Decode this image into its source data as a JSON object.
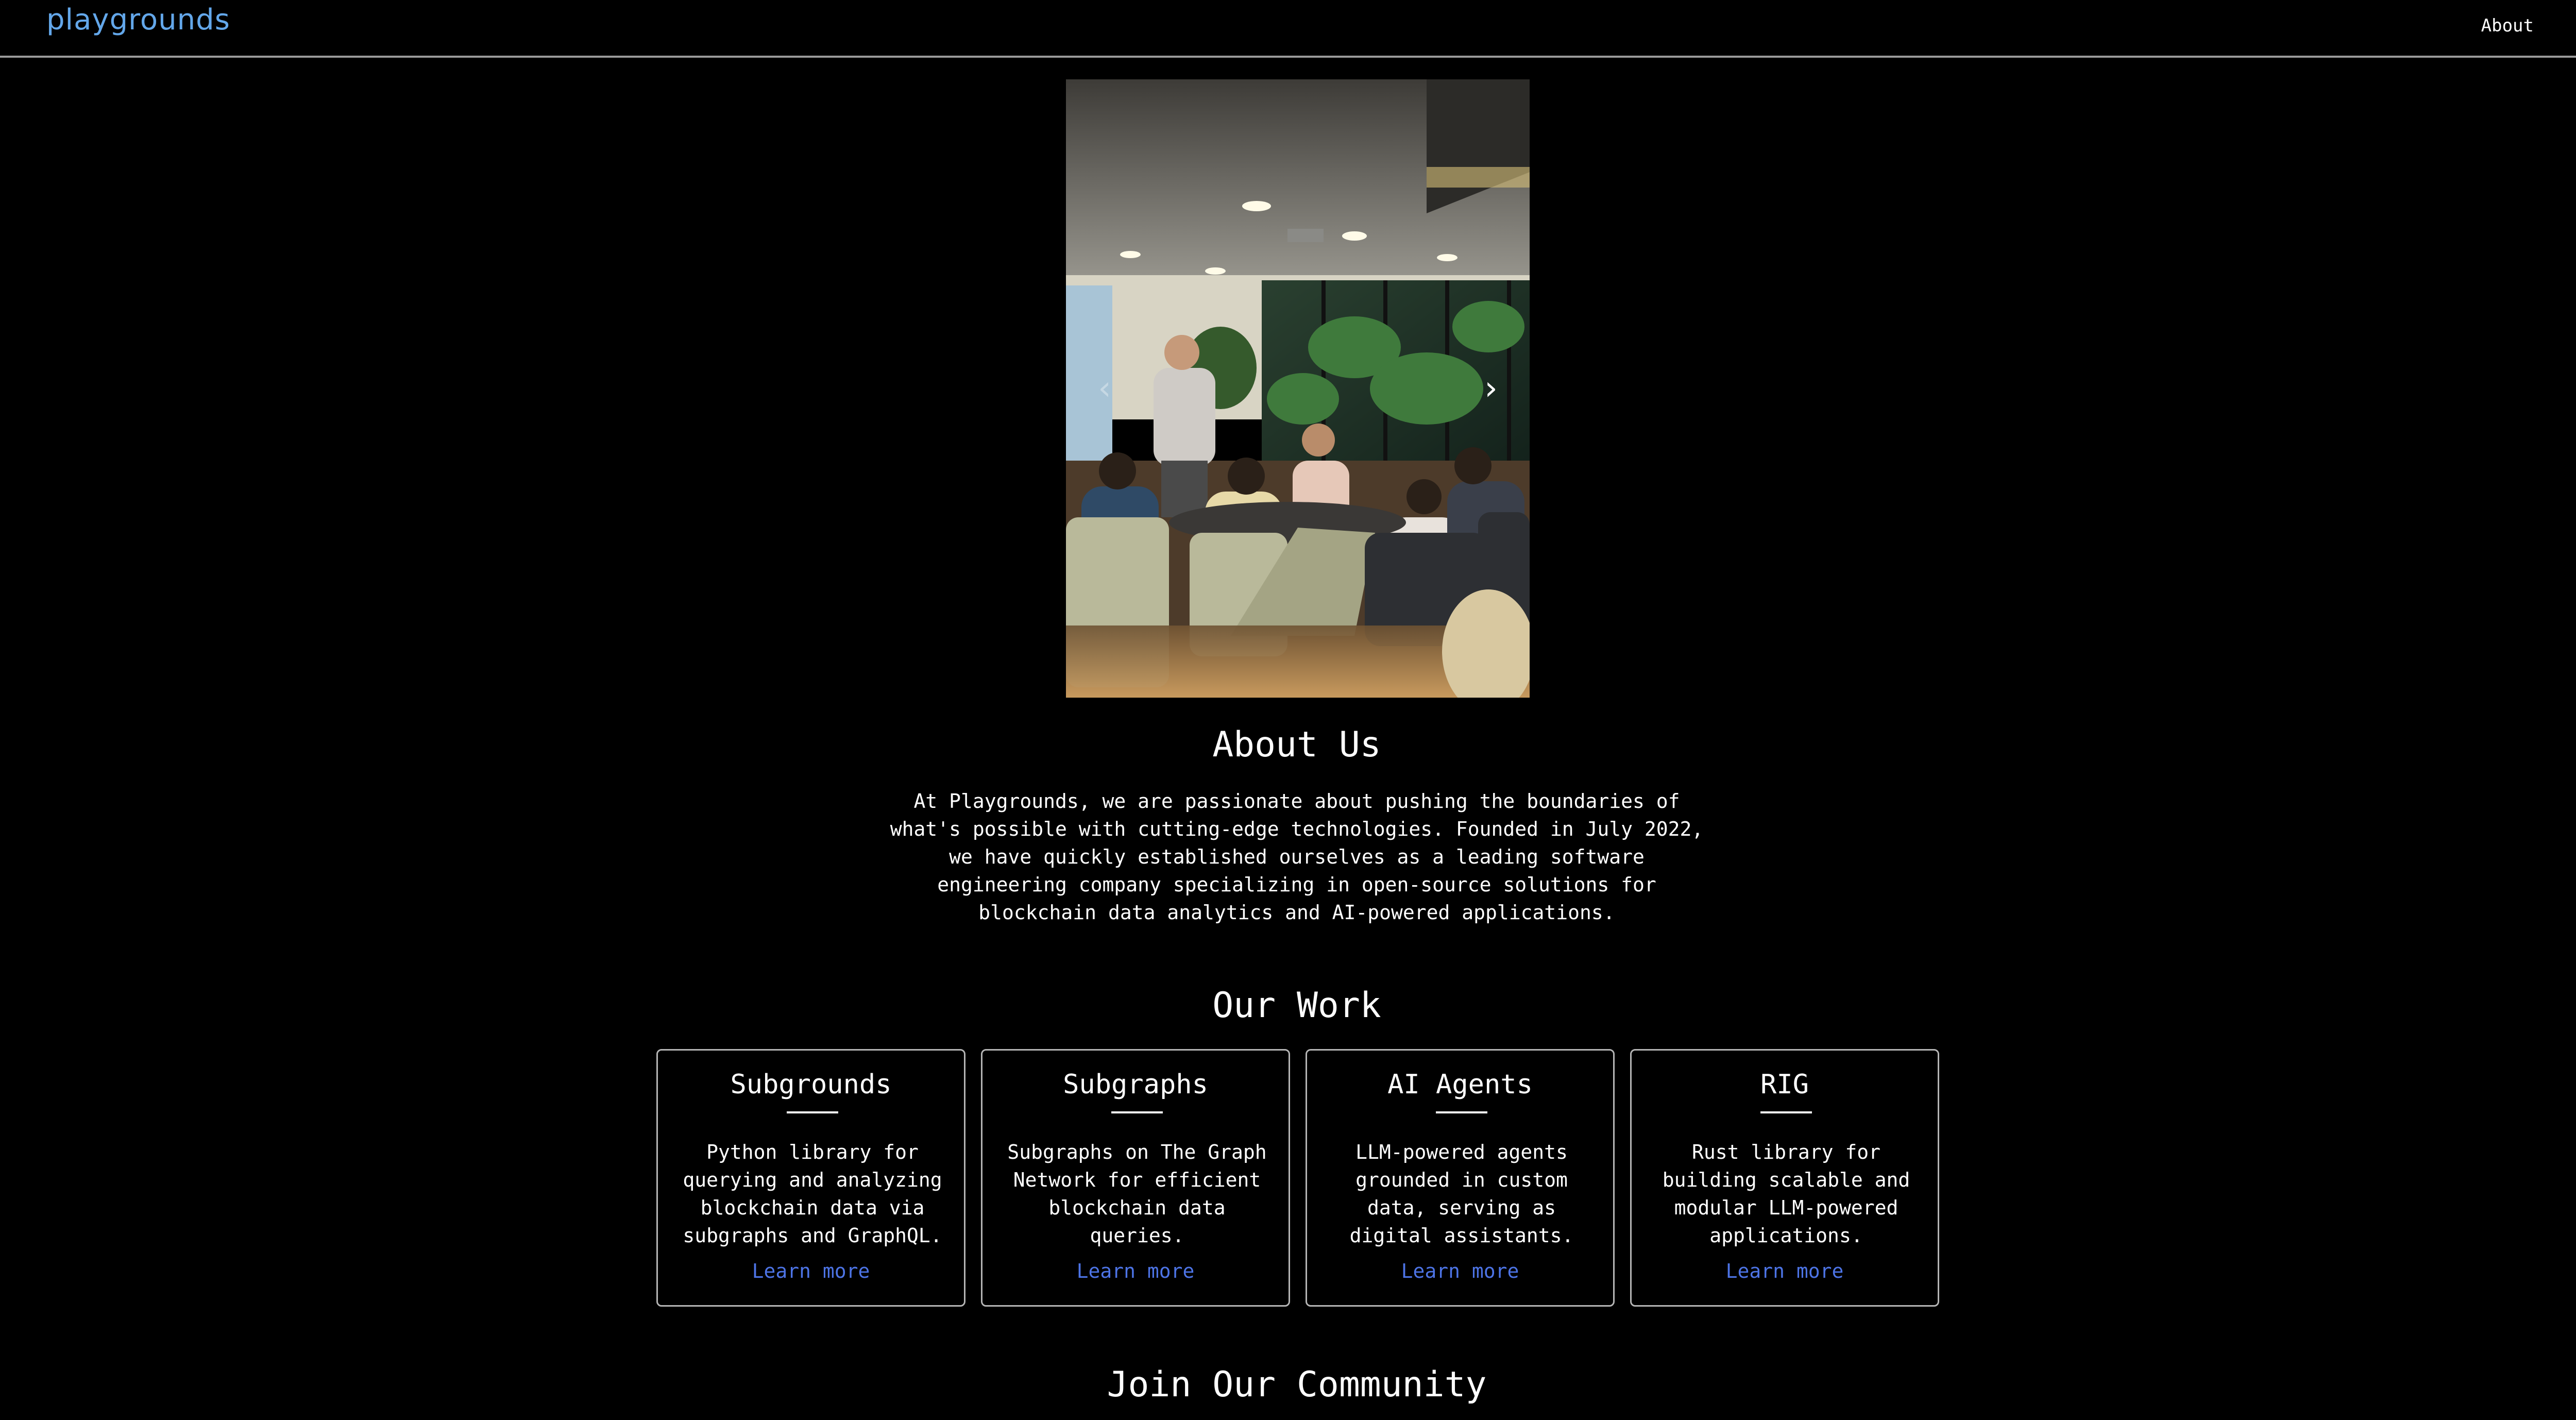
{
  "nav": {
    "logo": "playgrounds",
    "about_link": "About"
  },
  "carousel": {
    "prev_icon": "chevron-left-icon",
    "next_icon": "chevron-right-icon",
    "prev_glyph": "‹",
    "next_glyph": "›"
  },
  "about": {
    "title": "About Us",
    "text": "At Playgrounds, we are passionate about pushing the boundaries of what's possible with cutting-edge technologies. Founded in July 2022, we have quickly established ourselves as a leading software engineering company specializing in open-source solutions for blockchain data analytics and AI-powered applications."
  },
  "work": {
    "title": "Our Work",
    "cards": [
      {
        "title": "Subgrounds",
        "description": "Python library for querying and analyzing blockchain data via subgraphs and GraphQL.",
        "link": "Learn more"
      },
      {
        "title": "Subgraphs",
        "description": "Subgraphs on The Graph Network for efficient blockchain data queries.",
        "link": "Learn more"
      },
      {
        "title": "AI Agents",
        "description": "LLM-powered agents grounded in custom data, serving as digital assistants.",
        "link": "Learn more"
      },
      {
        "title": "RIG",
        "description": "Rust library for building scalable and modular LLM-powered applications.",
        "link": "Learn more"
      }
    ]
  },
  "community": {
    "title": "Join Our Community"
  },
  "colors": {
    "background": "#000000",
    "logo": "#63a7ea",
    "link": "#4d74e6",
    "card_border": "#b5b5b5"
  }
}
